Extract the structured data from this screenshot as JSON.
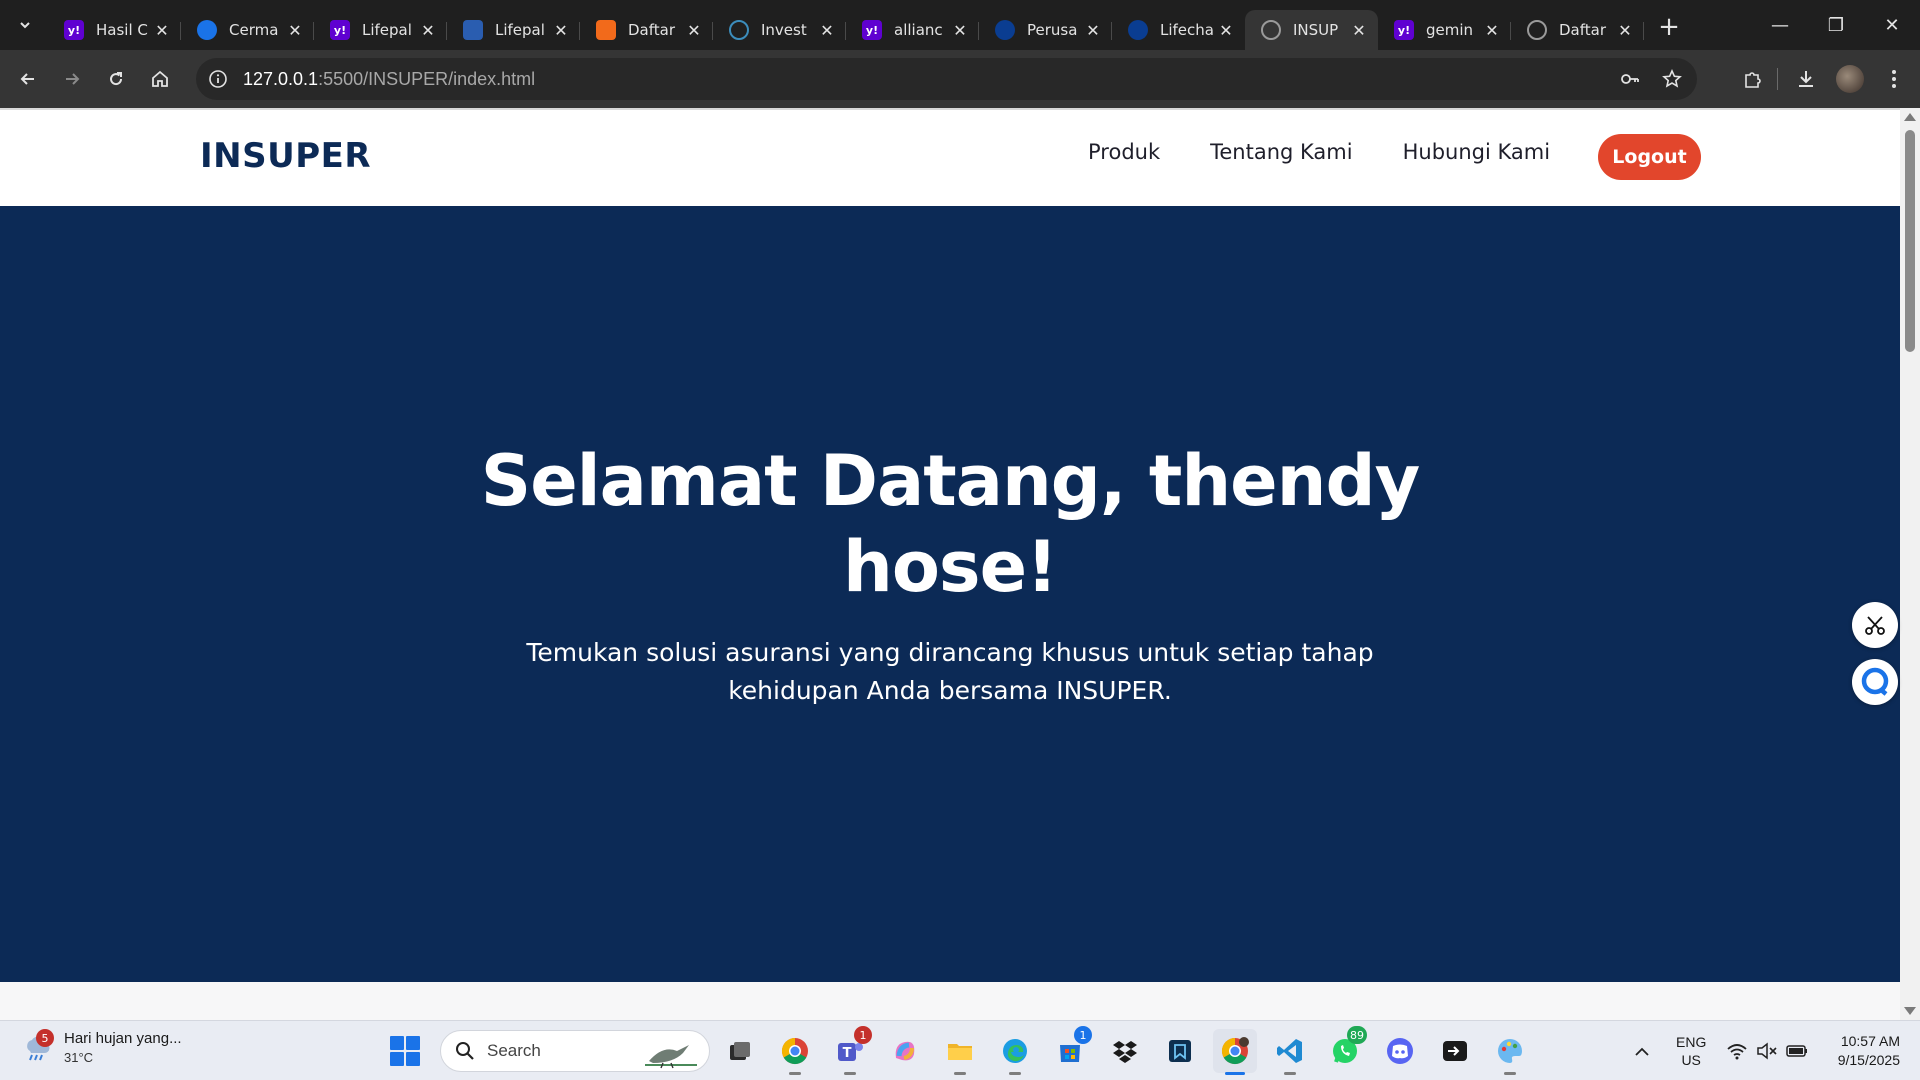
{
  "browser": {
    "tabs": [
      {
        "title": "Hasil C",
        "favicon": "yahoo-icon",
        "color": "#5f01d1"
      },
      {
        "title": "Cerma",
        "favicon": "blue-c-icon",
        "color": "#1a73e8"
      },
      {
        "title": "Lifepal",
        "favicon": "yahoo-icon",
        "color": "#5f01d1"
      },
      {
        "title": "Lifepal",
        "favicon": "lifepal-icon",
        "color": "#2a5db0"
      },
      {
        "title": "Daftar",
        "favicon": "orange-icon",
        "color": "#f26a1b"
      },
      {
        "title": "Invest",
        "favicon": "globe-icon",
        "color": "#3c8dbc"
      },
      {
        "title": "allianc",
        "favicon": "yahoo-icon",
        "color": "#5f01d1"
      },
      {
        "title": "Perusa",
        "favicon": "allianz-icon",
        "color": "#0a3d91"
      },
      {
        "title": "Lifecha",
        "favicon": "allianz-icon",
        "color": "#0a3d91"
      },
      {
        "title": "INSUP",
        "favicon": "globe-icon",
        "color": "#9a9a9a",
        "active": true
      },
      {
        "title": "gemin",
        "favicon": "yahoo-icon",
        "color": "#5f01d1"
      },
      {
        "title": "Daftar",
        "favicon": "globe-icon",
        "color": "#9a9a9a"
      }
    ],
    "url_host": "127.0.0.1",
    "url_path": ":5500/INSUPER/index.html"
  },
  "site": {
    "brand": "INSUPER",
    "nav": [
      "Produk",
      "Tentang Kami",
      "Hubungi Kami"
    ],
    "logout_label": "Logout",
    "hero_title": "Selamat Datang, thendy hose!",
    "hero_subtitle": "Temukan solusi asuransi yang dirancang khusus untuk setiap tahap kehidupan Anda bersama INSUPER.",
    "colors": {
      "navy": "#0c2a56",
      "accent": "#e2462c"
    }
  },
  "taskbar": {
    "weather_text": "Hari hujan yang...",
    "weather_temp": "31°C",
    "weather_badge": "5",
    "search_label": "Search",
    "badges": {
      "teams": "1",
      "store": "1",
      "whatsapp": "89"
    },
    "lang_top": "ENG",
    "lang_bottom": "US",
    "time": "10:57 AM",
    "date": "9/15/2025"
  }
}
